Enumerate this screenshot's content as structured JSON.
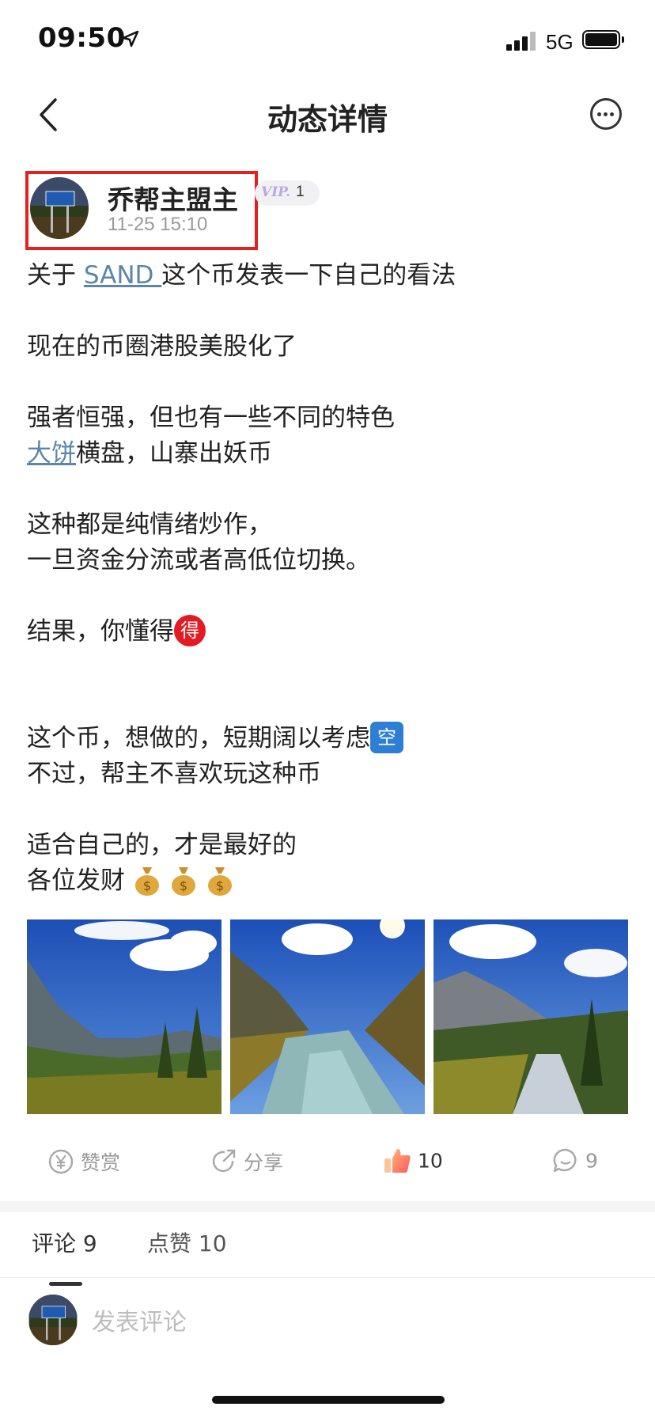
{
  "status_bar": {
    "time": "09:50",
    "network": "5G"
  },
  "nav": {
    "title": "动态详情"
  },
  "user": {
    "name": "乔帮主盟主",
    "post_time": "11-25 15:10",
    "vip_tag": "VIP.",
    "vip_level": "1"
  },
  "post": {
    "line1_pre": "关于 ",
    "line1_link": "SAND ",
    "line1_post": "这个币发表一下自己的看法",
    "line2": "现在的币圈港股美股化了",
    "line3": "强者恒强，但也有一些不同的特色",
    "line4_link": "大饼",
    "line4_post": "横盘，山寨出妖币",
    "line5": "这种都是纯情绪炒作，",
    "line6": "一旦资金分流或者高低位切换。",
    "line7": "结果，你懂得",
    "emoji_de": "得",
    "line8": "这个币，想做的，短期阔以考虑",
    "emoji_kong": "空",
    "line9": "不过，帮主不喜欢玩这种币",
    "line10": "适合自己的，才是最好的",
    "line11": "各位发财"
  },
  "actions": {
    "reward": "赞赏",
    "share": "分享",
    "like_count": "10",
    "comment_count": "9"
  },
  "tabs": {
    "comments": "评论 9",
    "likes": "点赞 10"
  },
  "comment_input": {
    "placeholder": "发表评论"
  }
}
